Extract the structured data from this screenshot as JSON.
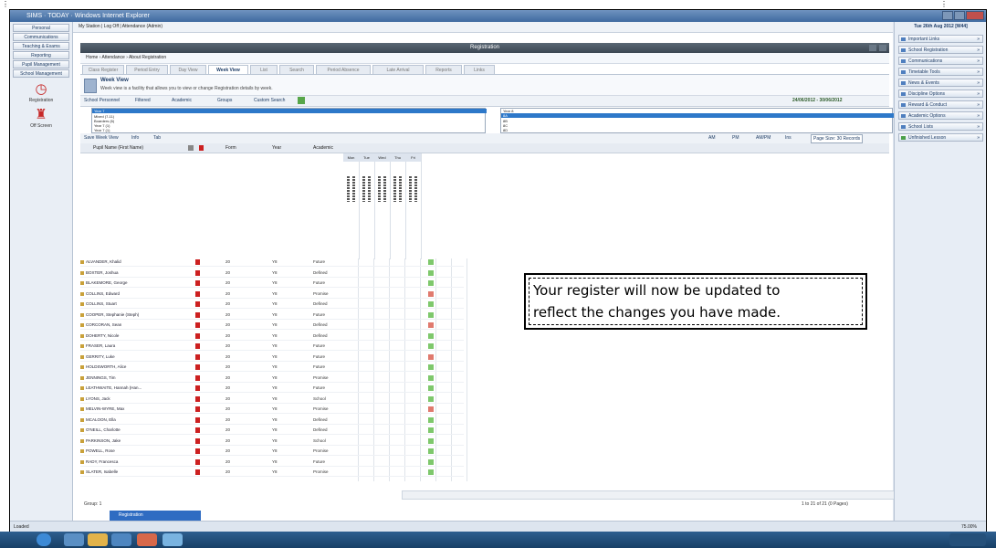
{
  "window": {
    "title": "SIMS · TODAY · Windows Internet Explorer"
  },
  "left_nav": {
    "items": [
      "Personal",
      "Communications",
      "Teaching & Exams",
      "Reporting",
      "Pupil Management",
      "School Management"
    ],
    "apps": [
      {
        "label": "Registration"
      },
      {
        "label": "Off Screen"
      }
    ]
  },
  "top_row": {
    "text": "My Station  |  Log Off  |  Attendance (Admin)"
  },
  "panel": {
    "title": "Registration"
  },
  "breadcrumb": {
    "text": "Home  ›  Attendance  ›  About Registration"
  },
  "tabs": [
    "Class Register",
    "Period Entry",
    "Day View",
    "Week View",
    "List",
    "Search",
    "Period Absence",
    "Late Arrival",
    "Reports",
    "Links"
  ],
  "active_tab": "Week View",
  "info": {
    "title": "Week View",
    "text": "Week view is a facility that allows you to view or change Registration details by week."
  },
  "toolbar": {
    "items": [
      "School Personnel",
      "Filtered",
      "Academic",
      "Groups",
      "Custom Search"
    ],
    "date_range": "24/06/2012 - 30/06/2012"
  },
  "list_left": [
    "Year 7",
    "Mixed (7-11)",
    "Boarders (6)",
    "Year 7 (1)",
    "Year 7 (1)"
  ],
  "list_right": [
    "Year 8",
    "8A",
    "8B",
    "8C",
    "8D"
  ],
  "grid_toolbar": {
    "left": [
      "Save Week View",
      "Info",
      "Tab"
    ],
    "right": [
      "AM",
      "PM",
      "AM/PM",
      "Ins",
      "Page Size: 30 Records"
    ]
  },
  "grid_header": {
    "name": "Pupil Name (First Name)",
    "form": "Form",
    "year": "Year",
    "academic": "Academic"
  },
  "days": [
    "Mon",
    "Tue",
    "Wed",
    "Thu",
    "Fri"
  ],
  "rows": [
    {
      "name": "ALVANDER, Khalid",
      "form": "20",
      "year": "Y8",
      "academic": "Future",
      "mark": "/"
    },
    {
      "name": "BOXTER, Joshua",
      "form": "20",
      "year": "Y8",
      "academic": "Defined",
      "mark": "/"
    },
    {
      "name": "BLAKEMORE, George",
      "form": "20",
      "year": "Y8",
      "academic": "Future",
      "mark": "/"
    },
    {
      "name": "COLLINS, Edward",
      "form": "20",
      "year": "Y8",
      "academic": "Promise",
      "mark": "N"
    },
    {
      "name": "COLLINS, Stuart",
      "form": "20",
      "year": "Y8",
      "academic": "Defined",
      "mark": "/"
    },
    {
      "name": "COOPER, Stephanie (Steph)",
      "form": "20",
      "year": "Y8",
      "academic": "Future",
      "mark": "/"
    },
    {
      "name": "CORCORAN, Sean",
      "form": "20",
      "year": "Y8",
      "academic": "Defined",
      "mark": "N"
    },
    {
      "name": "DOHERTY, Nicole",
      "form": "20",
      "year": "Y8",
      "academic": "Defined",
      "mark": "/"
    },
    {
      "name": "FRASER, Laura",
      "form": "20",
      "year": "Y8",
      "academic": "Future",
      "mark": "/"
    },
    {
      "name": "GERRITY, Luke",
      "form": "20",
      "year": "Y8",
      "academic": "Future",
      "mark": "N"
    },
    {
      "name": "HOLDSWORTH, Alice",
      "form": "20",
      "year": "Y8",
      "academic": "Future",
      "mark": "/"
    },
    {
      "name": "JENNINGS, Tim",
      "form": "20",
      "year": "Y8",
      "academic": "Promise",
      "mark": "/"
    },
    {
      "name": "LEATHWAITE, Hannah (Han...",
      "form": "20",
      "year": "Y8",
      "academic": "Future",
      "mark": "/"
    },
    {
      "name": "LYONS, Jack",
      "form": "20",
      "year": "Y8",
      "academic": "School",
      "mark": "/"
    },
    {
      "name": "MELVIN-WYRE, Max",
      "form": "20",
      "year": "Y8",
      "academic": "Promise",
      "mark": "N"
    },
    {
      "name": "MCALOON, Ella",
      "form": "20",
      "year": "Y8",
      "academic": "Defined",
      "mark": "/"
    },
    {
      "name": "O'NEILL, Charlotte",
      "form": "20",
      "year": "Y8",
      "academic": "Defined",
      "mark": "/"
    },
    {
      "name": "PARKINSON, Jake",
      "form": "20",
      "year": "Y8",
      "academic": "School",
      "mark": "/"
    },
    {
      "name": "POWELL, Rose",
      "form": "20",
      "year": "Y8",
      "academic": "Promise",
      "mark": "/"
    },
    {
      "name": "RADY, Francesca",
      "form": "20",
      "year": "Y8",
      "academic": "Future",
      "mark": "/"
    },
    {
      "name": "SLATER, Isabelle",
      "form": "20",
      "year": "Y8",
      "academic": "Promise",
      "mark": "/"
    }
  ],
  "status_row": {
    "left": "Group: 1",
    "right": "1 to 21 of 21 (0 Pages)"
  },
  "bottom_tab": {
    "label": "Registration"
  },
  "callout": {
    "line1": "Your register will now be updated to",
    "line2": "reflect the changes you have made."
  },
  "right_pane": {
    "date": "Tue 26th Aug 2012 [W44]",
    "items": [
      "Important Links",
      "School Registration",
      "Communications",
      "Timetable Tools",
      "News & Events",
      "Discipline Options",
      "Reward & Conduct",
      "Academic Options",
      "School Lists",
      "Unfinished Lesson"
    ]
  },
  "status_bar": {
    "left": "Loaded",
    "right": "75.00%"
  },
  "colors": {
    "accent": "#2f6cc2",
    "present": "#7ec86c",
    "absent": "#e07a6e"
  }
}
